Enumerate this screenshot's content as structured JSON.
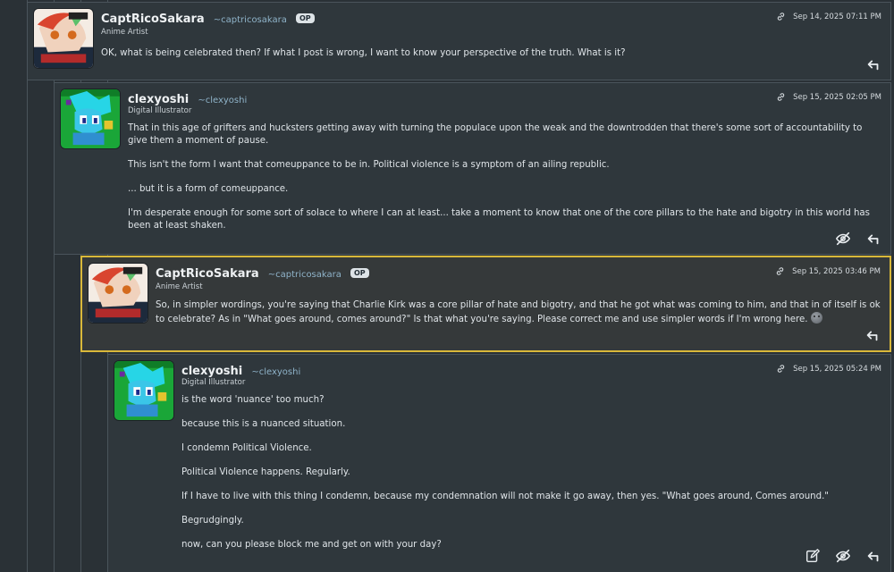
{
  "colors": {
    "background": "#2a3136",
    "card": "#2f373c",
    "highlight_border": "#d9b83a",
    "handle": "#8fb3c9"
  },
  "comments": [
    {
      "username": "CaptRicoSakara",
      "handle": "~captricosakara",
      "badge": "OP",
      "title": "Anime Artist",
      "date": "Sep 14, 2025 07:11 PM",
      "paragraphs": [
        "OK, what is being celebrated then? If what I post is wrong, I want to know your perspective of the truth. What is it?"
      ],
      "actions": [
        "reply-icon"
      ]
    },
    {
      "username": "clexyoshi",
      "handle": "~clexyoshi",
      "title": "Digital Illustrator",
      "date": "Sep 15, 2025 02:05 PM",
      "paragraphs": [
        "That in this age of grifters and hucksters getting away with turning the populace upon the weak and the downtrodden that there's some sort of accountability to give them a moment of pause.",
        "This isn't the form I want that comeuppance to be in. Political violence is a symptom of an ailing republic.",
        "... but it is a form of comeuppance.",
        "I'm desperate enough for some sort of solace to where I can at least... take a moment to know that one of the core pillars to the hate and bigotry in this world has been at least shaken."
      ],
      "actions": [
        "hide-icon",
        "reply-icon"
      ]
    },
    {
      "username": "CaptRicoSakara",
      "handle": "~captricosakara",
      "badge": "OP",
      "title": "Anime Artist",
      "date": "Sep 15, 2025 03:46 PM",
      "paragraphs": [
        "So, in simpler wordings, you're saying that Charlie Kirk was a core pillar of hate and bigotry, and that he got what was coming to him, and that in of itself is ok to celebrate? As in \"What goes around, comes around?\" Is that what you're saying. Please correct me and use simpler words if I'm wrong here."
      ],
      "emoji": "neutral-face-emoji",
      "actions": [
        "reply-icon"
      ]
    },
    {
      "username": "clexyoshi",
      "handle": "~clexyoshi",
      "title": "Digital Illustrator",
      "date": "Sep 15, 2025 05:24 PM",
      "paragraphs": [
        "is the word 'nuance' too much?",
        "because this is a nuanced situation.",
        "I condemn Political Violence.",
        "Political Violence happens. Regularly.",
        "If I have to live with this thing I condemn, because my condemnation will not make it go away, then yes. \"What goes around, Comes around.\"",
        "Begrudgingly.",
        "now, can you please block me and get on with your day?"
      ],
      "actions": [
        "edit-icon",
        "hide-icon",
        "reply-icon"
      ]
    }
  ]
}
